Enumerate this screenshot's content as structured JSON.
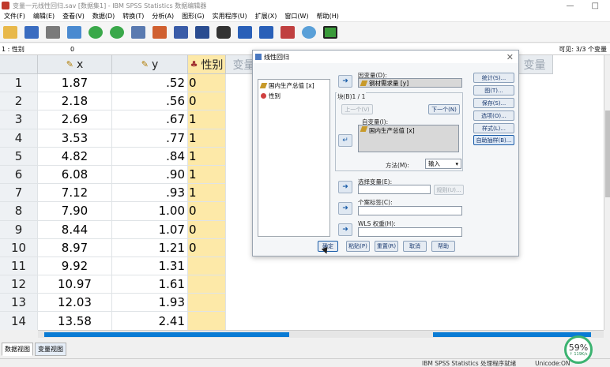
{
  "window": {
    "title": "变量一元线性回归.sav [数据集1] - IBM SPSS Statistics 数据编辑器",
    "controls": [
      "—",
      "□"
    ]
  },
  "menu": [
    "文件(F)",
    "编辑(E)",
    "查看(V)",
    "数据(D)",
    "转换(T)",
    "分析(A)",
    "图形(G)",
    "实用程序(U)",
    "扩展(X)",
    "窗口(W)",
    "帮助(H)"
  ],
  "cellbar": {
    "ref": "1 : 性别",
    "value": "0",
    "visible": "可见: 3/3 个变量"
  },
  "grid": {
    "columns": {
      "x": "x",
      "y": "y",
      "sex": "性别",
      "empty": "变量"
    },
    "rows": [
      {
        "n": "1",
        "x": "1.87",
        "y": ".52",
        "sex": "0"
      },
      {
        "n": "2",
        "x": "2.18",
        "y": ".56",
        "sex": "0"
      },
      {
        "n": "3",
        "x": "2.69",
        "y": ".67",
        "sex": "1"
      },
      {
        "n": "4",
        "x": "3.53",
        "y": ".77",
        "sex": "1"
      },
      {
        "n": "5",
        "x": "4.82",
        "y": ".84",
        "sex": "1"
      },
      {
        "n": "6",
        "x": "6.08",
        "y": ".90",
        "sex": "1"
      },
      {
        "n": "7",
        "x": "7.12",
        "y": ".93",
        "sex": "1"
      },
      {
        "n": "8",
        "x": "7.90",
        "y": "1.00",
        "sex": "0"
      },
      {
        "n": "9",
        "x": "8.44",
        "y": "1.07",
        "sex": "0"
      },
      {
        "n": "10",
        "x": "8.97",
        "y": "1.21",
        "sex": "0"
      },
      {
        "n": "11",
        "x": "9.92",
        "y": "1.31",
        "sex": ""
      },
      {
        "n": "12",
        "x": "10.97",
        "y": "1.61",
        "sex": ""
      },
      {
        "n": "13",
        "x": "12.03",
        "y": "1.93",
        "sex": ""
      },
      {
        "n": "14",
        "x": "13.58",
        "y": "2.41",
        "sex": ""
      }
    ]
  },
  "tabs": {
    "data_view": "数据视图",
    "variable_view": "变量视图"
  },
  "status": {
    "processor": "IBM SPSS Statistics 处理程序就绪",
    "unicode": "Unicode:ON"
  },
  "progress": {
    "percent": "59%",
    "speed": "↑ 119K/s"
  },
  "dialog": {
    "title": "线性回归",
    "source_vars": [
      "国内生产总值 [x]",
      "性别"
    ],
    "dependent_label": "因变量(D):",
    "dependent_value": "钢材需求量 [y]",
    "block_label": "块(B)1 / 1",
    "prev_button": "上一个(V)",
    "next_button": "下一个(N)",
    "independent_label": "自变量(I):",
    "independent_value": "国内生产总值 [x]",
    "method_label": "方法(M):",
    "method_value": "输入",
    "selection_label": "选择变量(E):",
    "rule_button": "规则(U)...",
    "case_label": "个案标签(C):",
    "wls_label": "WLS 权重(H):",
    "side_buttons": [
      "统计(S)...",
      "图(T)...",
      "保存(S)...",
      "选项(O)...",
      "样式(L)...",
      "自助抽样(B)..."
    ],
    "bottom_buttons": [
      "确定",
      "粘贴(P)",
      "重置(R)",
      "取消",
      "帮助"
    ]
  }
}
